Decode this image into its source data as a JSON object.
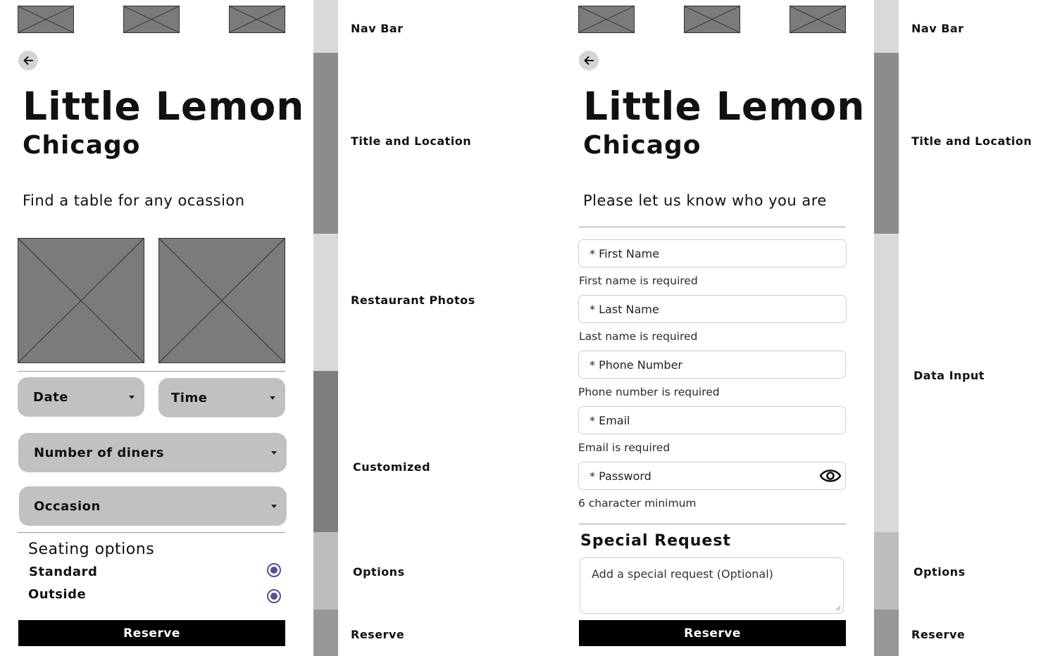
{
  "left_screen": {
    "title": "Little Lemon",
    "location": "Chicago",
    "tagline": "Find a table for any ocassion",
    "date_select": "Date",
    "time_select": "Time",
    "diners_select": "Number of diners",
    "occasion_select": "Occasion",
    "seating_heading": "Seating options",
    "seating_options": [
      "Standard",
      "Outside"
    ],
    "reserve_label": "Reserve"
  },
  "left_annotations": {
    "nav": "Nav Bar",
    "title": "Title  and Location",
    "photos": "Restaurant Photos",
    "customized": "Customized",
    "options": "Options",
    "reserve": "Reserve"
  },
  "right_screen": {
    "title": "Little Lemon",
    "location": "Chicago",
    "tagline": "Please let us know who you are",
    "fields": [
      {
        "placeholder": "* First Name",
        "helper": "First name is required"
      },
      {
        "placeholder": "* Last Name",
        "helper": "Last name is required"
      },
      {
        "placeholder": "* Phone Number",
        "helper": "Phone number is required"
      },
      {
        "placeholder": "* Email",
        "helper": "Email is required"
      },
      {
        "placeholder": "* Password",
        "helper": "6 character minimum"
      }
    ],
    "special_heading": "Special  Request",
    "special_placeholder": "Add a special request (Optional)",
    "reserve_label": "Reserve"
  },
  "right_annotations": {
    "nav": "Nav Bar",
    "title": "Title  and Location",
    "data_input": "Data Input",
    "options": "Options",
    "reserve": "Reserve"
  },
  "colors": {
    "placeholder_fill": "#7b7b7b",
    "pill": "#c1c1c1",
    "radio_accent": "#5e4f8c",
    "button": "#000000",
    "band_nav": "#d9d9d9",
    "band_title": "#8c8c8c",
    "band_photos": "#d9d9d9",
    "band_customized": "#7e7e7e",
    "band_options": "#bdbdbd",
    "band_reserve": "#979797"
  },
  "icons": {
    "back": "back-arrow-icon",
    "password_toggle": "eye-icon",
    "dropdown": "caret-down-icon",
    "placeholder": "image-placeholder-icon"
  }
}
